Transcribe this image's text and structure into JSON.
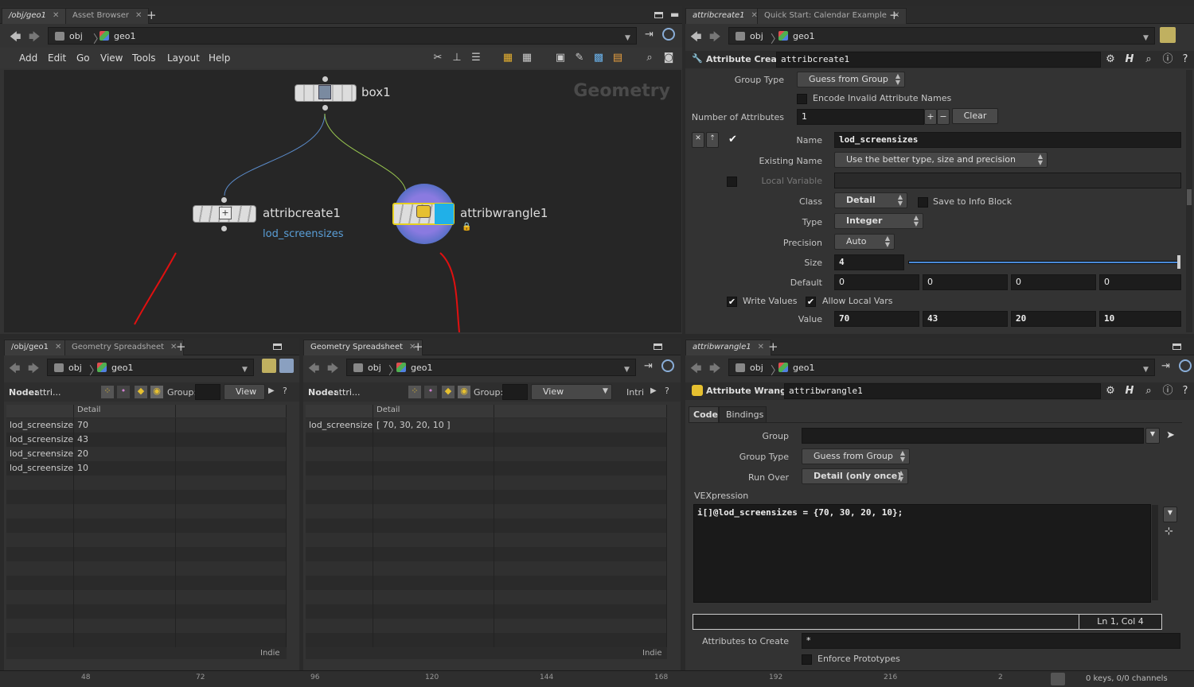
{
  "left_top": {
    "tabs": [
      "/obj/geo1",
      "Asset Browser"
    ],
    "path": [
      "obj",
      "geo1"
    ],
    "menu": [
      "Add",
      "Edit",
      "Go",
      "View",
      "Tools",
      "Layout",
      "Help"
    ],
    "network_label": "Geometry",
    "nodes": {
      "box": {
        "name": "box1"
      },
      "create": {
        "name": "attribcreate1",
        "sub": "lod_screensizes"
      },
      "wrangle": {
        "name": "attribwrangle1"
      }
    }
  },
  "right_top": {
    "tabs": [
      "attribcreate1",
      "Quick Start: Calendar Example"
    ],
    "path": [
      "obj",
      "geo1"
    ],
    "title": "Attribute Create",
    "node_name": "attribcreate1",
    "group_type_label": "Group Type",
    "group_type": "Guess from Group",
    "encode_label": "Encode Invalid Attribute Names",
    "num_attrs_label": "Number of Attributes",
    "num_attrs": "1",
    "clear": "Clear",
    "name_label": "Name",
    "name_value": "lod_screensizes",
    "existing_label": "Existing Name",
    "existing_value": "Use the better type, size and precision",
    "local_var_label": "Local Variable",
    "class_label": "Class",
    "class_value": "Detail",
    "save_info": "Save to Info Block",
    "type_label": "Type",
    "type_value": "Integer",
    "precision_label": "Precision",
    "precision_value": "Auto",
    "size_label": "Size",
    "size_value": "4",
    "size_fraction": 1.0,
    "default_label": "Default",
    "defaults": [
      "0",
      "0",
      "0",
      "0"
    ],
    "write_values": "Write Values",
    "allow_local": "Allow Local Vars",
    "value_label": "Value",
    "values": [
      "70",
      "43",
      "20",
      "10"
    ]
  },
  "bottom_left": {
    "tabs": [
      "/obj/geo1",
      "Geometry Spreadsheet"
    ],
    "path": [
      "obj",
      "geo1"
    ],
    "node_label": "Node:",
    "node_value": "attri...",
    "group_label": "Group:",
    "view": "View",
    "col_header": "Detail",
    "rows": [
      [
        "lod_screensizes",
        "70"
      ],
      [
        "lod_screensizes",
        "43"
      ],
      [
        "lod_screensizes",
        "20"
      ],
      [
        "lod_screensizes",
        "10"
      ]
    ],
    "footer": "Indie"
  },
  "bottom_mid": {
    "tabs": [
      "Geometry Spreadsheet"
    ],
    "path": [
      "obj",
      "geo1"
    ],
    "node_label": "Node:",
    "node_value": "attri...",
    "group_label": "Group:",
    "view": "View",
    "intrinsic": "Intri",
    "col_header": "Detail",
    "rows": [
      [
        "lod_screensizes",
        "[ 70, 30, 20, 10 ]"
      ]
    ],
    "footer": "Indie"
  },
  "bottom_right": {
    "tabs": [
      "attribwrangle1"
    ],
    "path": [
      "obj",
      "geo1"
    ],
    "title": "Attribute Wrangle",
    "node_name": "attribwrangle1",
    "subtabs": [
      "Code",
      "Bindings"
    ],
    "group_label": "Group",
    "group_type_label": "Group Type",
    "group_type": "Guess from Group",
    "run_over_label": "Run Over",
    "run_over": "Detail (only once)",
    "vex_label": "VEXpression",
    "vex_code": "i[]@lod_screensizes = {70, 30, 20, 10};",
    "cursor": "Ln 1, Col 4",
    "attrs_create_label": "Attributes to Create",
    "attrs_create": "*",
    "enforce": "Enforce Prototypes"
  },
  "timeline": {
    "ticks": [
      "48",
      "72",
      "96",
      "120",
      "144",
      "168",
      "192",
      "216",
      "2"
    ],
    "status": "0 keys, 0/0 channels"
  },
  "colors": {
    "accent_blue": "#4a8ad8",
    "annotation_red": "#e01010",
    "link_blue": "#5a9fd8",
    "wrangle_circle": "#6a60c0"
  }
}
